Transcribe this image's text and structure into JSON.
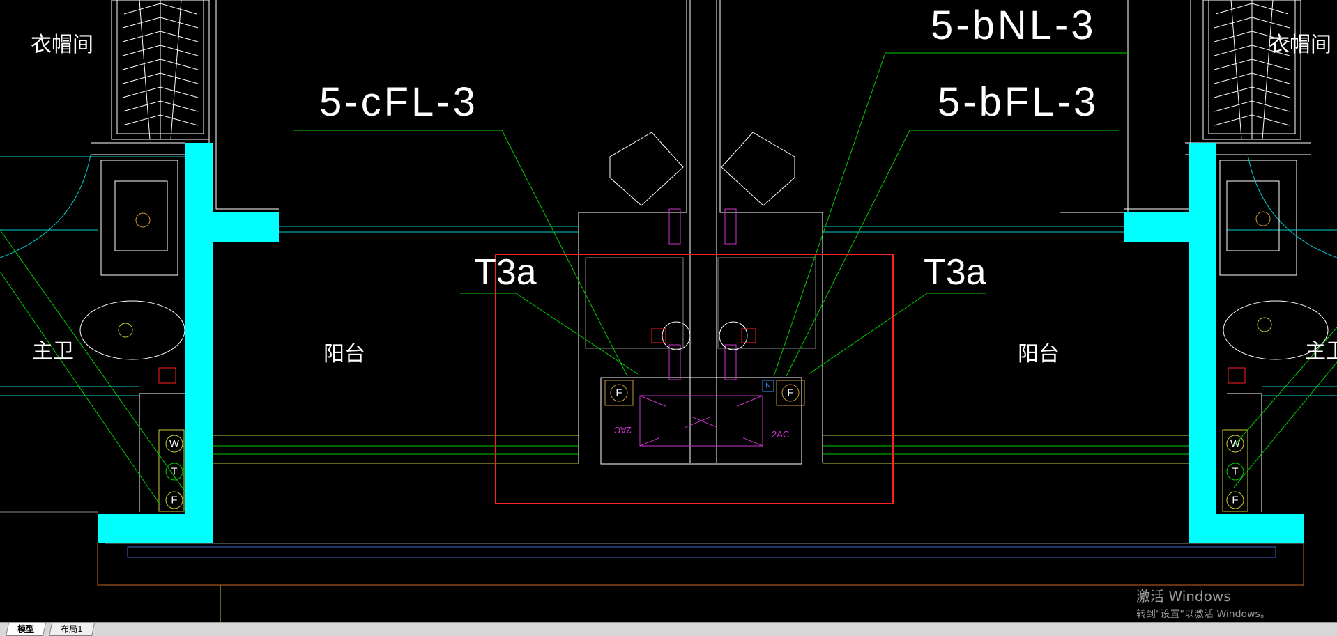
{
  "drawing": {
    "rooms": {
      "cloakroom_left": "衣帽间",
      "cloakroom_right": "衣帽间",
      "master_bath_left": "主卫",
      "master_bath_right": "主卫",
      "balcony_left": "阳台",
      "balcony_right": "阳台"
    },
    "tags": {
      "cfl": "5-cFL-3",
      "bnl": "5-bNL-3",
      "bfl": "5-bFL-3",
      "t3a_left": "T3a",
      "t3a_right": "T3a"
    },
    "equipment": {
      "ac_left": "2AC",
      "ac_right": "2AC",
      "drain_left": "F",
      "drain_right": "F",
      "n_marker": "N"
    },
    "pipe_symbols": {
      "left": [
        "W",
        "T",
        "F"
      ],
      "right": [
        "W",
        "T",
        "F"
      ]
    },
    "colors": {
      "wall": "#00ffff",
      "selection": "#ff2020",
      "leader": "#00cc00",
      "line_yellow": "#cccc33",
      "equipment": "#cc33cc"
    }
  },
  "watermark": {
    "title": "激活 Windows",
    "subtitle": "转到\"设置\"以激活 Windows。"
  },
  "tabs": {
    "model": "模型",
    "layout1": "布局1"
  }
}
